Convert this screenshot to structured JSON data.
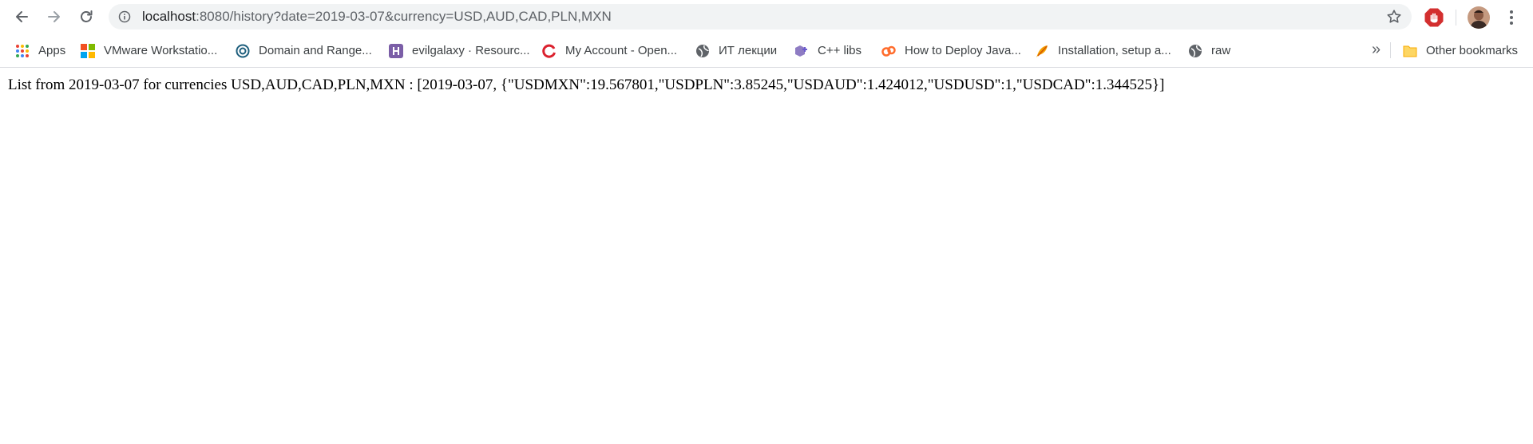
{
  "toolbar": {
    "url_host": "localhost",
    "url_rest": ":8080/history?date=2019-03-07&currency=USD,AUD,CAD,PLN,MXN",
    "back_icon": "arrow-left-icon",
    "forward_icon": "arrow-right-icon",
    "reload_icon": "reload-icon",
    "info_icon": "info-icon",
    "bookmark_star_icon": "star-outline-icon",
    "extension_icon": "adblock-hand-icon",
    "menu_icon": "vertical-dots-icon"
  },
  "bookmarks": {
    "items": [
      {
        "label": "Apps",
        "icon": "apps-grid-icon"
      },
      {
        "label": "VMware Workstatio...",
        "icon": "vmware-icon"
      },
      {
        "label": "Domain and Range...",
        "icon": "circle-logo-icon"
      },
      {
        "label": "evilgalaxy · Resourc...",
        "icon": "h-logo-icon"
      },
      {
        "label": "My Account - Open...",
        "icon": "openshift-icon"
      },
      {
        "label": "ИТ лекции",
        "icon": "globe-icon"
      },
      {
        "label": "C++ libs",
        "icon": "cpp-icon"
      },
      {
        "label": "How to Deploy Java...",
        "icon": "cp-logo-icon"
      },
      {
        "label": "Installation, setup a...",
        "icon": "feather-icon"
      },
      {
        "label": "raw",
        "icon": "globe-icon"
      }
    ],
    "more_label": "»",
    "other_label": "Other bookmarks",
    "other_icon": "folder-icon"
  },
  "page": {
    "text": "List from 2019-03-07 for currencies USD,AUD,CAD,PLN,MXN : [2019-03-07, {\"USDMXN\":19.567801,\"USDPLN\":3.85245,\"USDAUD\":1.424012,\"USDUSD\":1,\"USDCAD\":1.344525}]"
  },
  "colors": {
    "omnibox_bg": "#f1f3f4",
    "text_primary": "#202124",
    "text_secondary": "#5f6368",
    "adblock_red": "#d32f2f"
  }
}
